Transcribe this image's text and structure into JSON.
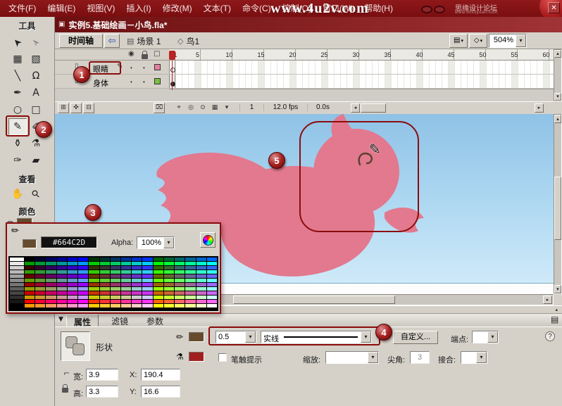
{
  "menu": {
    "items": [
      "文件(F)",
      "编辑(E)",
      "视图(V)",
      "插入(I)",
      "修改(M)",
      "文本(T)",
      "命令(C)",
      "控制(O)",
      "窗口(W)",
      "帮助(H)"
    ],
    "watermark": "www.4u2v.com",
    "brand": "思缘设计论坛",
    "brand_url": "www.missyuan.com"
  },
  "window": {
    "title": "实例5.基础绘画－小鸟.fla*",
    "close_glyph": "✕",
    "doc_glyph": "▣"
  },
  "edit_bar": {
    "timeline_tab": "时间轴",
    "back_glyph": "⇦",
    "scene_icon": "▤",
    "scene": "场景 1",
    "symbol_icon": "◇",
    "symbol": "鸟1",
    "zoom": "504%"
  },
  "timeline": {
    "layers": [
      {
        "name": "眼睛",
        "outline_color": "#E87EA0",
        "keyframe": "hollow"
      },
      {
        "name": "身体",
        "outline_color": "#7AC143",
        "keyframe": "filled"
      }
    ],
    "frame_labels": [
      1,
      5,
      10,
      15,
      20,
      25,
      30,
      35,
      40,
      45,
      50,
      55,
      60
    ],
    "current_frame": "1",
    "fps": "12.0 fps",
    "time": "0.0s",
    "layer_glyph": "▯",
    "edit_pencil": "✎",
    "controls": {
      "eye": "◉",
      "outline": "□",
      "add_layer": "⊞",
      "guide": "✜",
      "folder": "⊟",
      "trash": "⌧",
      "center": "⌖",
      "onion": "◎",
      "onion_outline": "⊙",
      "multi": "▦",
      "marker_menu": "▾"
    }
  },
  "tools": {
    "title": "工具",
    "grid": [
      {
        "name": "selection-tool",
        "glyph": "➤",
        "rot": -135
      },
      {
        "name": "subselection-tool",
        "glyph": "➢",
        "rot": -135
      },
      {
        "name": "free-transform-tool",
        "glyph": "▦",
        "rot": 0
      },
      {
        "name": "gradient-transform-tool",
        "glyph": "▧",
        "rot": 0
      },
      {
        "name": "line-tool",
        "glyph": "╲",
        "rot": 0
      },
      {
        "name": "lasso-tool",
        "glyph": "Ω",
        "rot": 0
      },
      {
        "name": "pen-tool",
        "glyph": "✒",
        "rot": 0
      },
      {
        "name": "text-tool",
        "glyph": "A",
        "rot": 0
      },
      {
        "name": "oval-tool",
        "glyph": "○",
        "rot": 0
      },
      {
        "name": "rectangle-tool",
        "glyph": "□",
        "rot": 0
      },
      {
        "name": "pencil-tool",
        "glyph": "✎",
        "rot": 0
      },
      {
        "name": "brush-tool",
        "glyph": "✐",
        "rot": 0
      },
      {
        "name": "ink-bottle-tool",
        "glyph": "⚱",
        "rot": 0
      },
      {
        "name": "paint-bucket-tool",
        "glyph": "⚗",
        "rot": 0
      },
      {
        "name": "eyedropper-tool",
        "glyph": "✑",
        "rot": 0
      },
      {
        "name": "eraser-tool",
        "glyph": "▰",
        "rot": 0
      }
    ],
    "view_title": "查看",
    "view_grid": [
      {
        "name": "hand-tool",
        "glyph": "✋",
        "rot": 0
      },
      {
        "name": "zoom-tool",
        "glyph": "⚲",
        "rot": -45
      }
    ],
    "color_title": "颜色"
  },
  "color_picker": {
    "hex": "#664C2D",
    "alpha_label": "Alpha:",
    "alpha_value": "100%",
    "stroke_color": "#664C2D",
    "steps": [
      "00",
      "33",
      "66",
      "99",
      "CC",
      "FF"
    ],
    "rows": 12,
    "cols": 18
  },
  "stage": {
    "bird_color": "#E2798E",
    "sketch_color": "#5C4130",
    "annotation_color": "#8B0C0C",
    "cursor_glyph": "✎"
  },
  "properties": {
    "tabs": [
      "属性",
      "滤镜",
      "参数"
    ],
    "shape_label": "形状",
    "stroke_width": "0.5",
    "stroke_style": "实线",
    "custom_button": "自定义...",
    "cap_label": "端点:",
    "hint_label": "笔触提示",
    "scale_label": "缩放:",
    "miter_label": "尖角:",
    "miter_value": "3",
    "join_label": "接合:",
    "width_label": "宽:",
    "width_value": "3.9",
    "height_label": "高:",
    "height_value": "3.3",
    "x_label": "X:",
    "x_value": "190.4",
    "y_label": "Y:",
    "y_value": "16.6",
    "help_glyph": "?",
    "fill_color": "#A02020",
    "icons": {
      "pencil": "✏",
      "bucket": "⚗",
      "corner": "⌐",
      "panel_menu": "▤",
      "collapse": "▼"
    }
  },
  "ui": {
    "dropdown": "▾",
    "up": "▴",
    "left": "◂",
    "right": "▸"
  },
  "markers": {
    "m1": "1",
    "m2": "2",
    "m3": "3",
    "m4": "4",
    "m5": "5"
  }
}
